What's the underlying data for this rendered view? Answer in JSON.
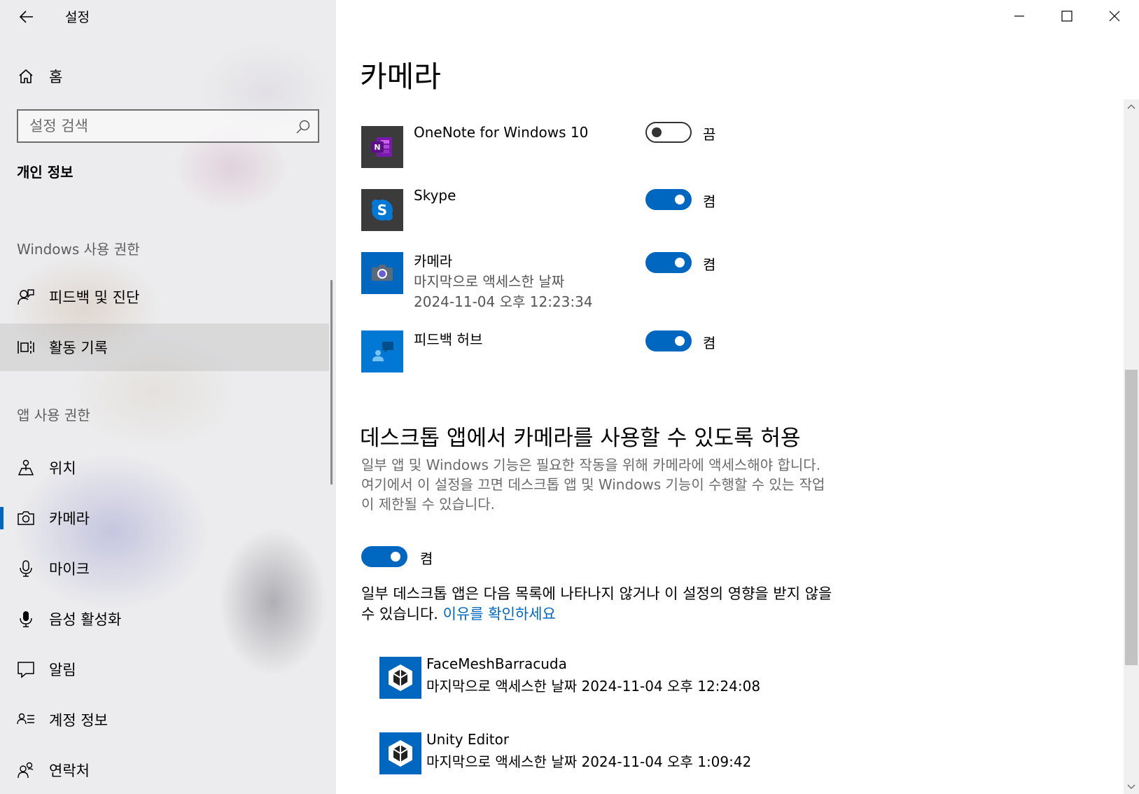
{
  "window": {
    "app_title": "설정",
    "back_icon": "back-arrow-icon",
    "minimize_icon": "minimize-icon",
    "maximize_icon": "maximize-icon",
    "close_icon": "close-icon"
  },
  "sidebar": {
    "home": {
      "label": "홈",
      "icon": "home-icon"
    },
    "search": {
      "placeholder": "설정 검색",
      "value": "",
      "icon": "search-icon"
    },
    "category": "개인 정보",
    "windows_section": "Windows 사용 권한",
    "windows_items": [
      {
        "label": "피드백 및 진단",
        "icon": "feedback-icon"
      },
      {
        "label": "활동 기록",
        "icon": "activity-history-icon"
      }
    ],
    "app_section": "앱 사용 권한",
    "app_items": [
      {
        "label": "위치",
        "icon": "location-icon"
      },
      {
        "label": "카메라",
        "icon": "camera-icon"
      },
      {
        "label": "마이크",
        "icon": "microphone-icon"
      },
      {
        "label": "음성 활성화",
        "icon": "voice-activation-icon"
      },
      {
        "label": "알림",
        "icon": "notifications-icon"
      },
      {
        "label": "계정 정보",
        "icon": "account-info-icon"
      },
      {
        "label": "연락처",
        "icon": "contacts-icon"
      }
    ],
    "active_item": "카메라",
    "hover_item": "활동 기록"
  },
  "main": {
    "title": "카메라",
    "apps": [
      {
        "name": "OneNote for Windows 10",
        "icon": "onenote-icon",
        "toggle": false,
        "state_label": "끔"
      },
      {
        "name": "Skype",
        "icon": "skype-icon",
        "toggle": true,
        "state_label": "켬"
      },
      {
        "name": "카메라",
        "icon": "camera-app-icon",
        "toggle": true,
        "state_label": "켬",
        "sub1": "마지막으로 액세스한 날짜",
        "sub2": "2024-11-04 오후 12:23:34"
      },
      {
        "name": "피드백 허브",
        "icon": "feedback-hub-icon",
        "toggle": true,
        "state_label": "켬"
      }
    ],
    "desktop_section": {
      "title": "데스크톱 앱에서 카메라를 사용할 수 있도록 허용",
      "description": "일부 앱 및 Windows 기능은 필요한 작동을 위해 카메라에 액세스해야 합니다. 여기에서 이 설정을 끄면 데스크톱 앱 및 Windows 기능이 수행할 수 있는 작업이 제한될 수 있습니다.",
      "toggle": true,
      "state_label": "켬",
      "note": "일부 데스크톱 앱은 다음 목록에 나타나지 않거나 이 설정의 영향을 받지 않을 수 있습니다. ",
      "link": "이유를 확인하세요",
      "apps": [
        {
          "name": "FaceMeshBarracuda",
          "icon": "unity-icon",
          "accessed": "마지막으로 액세스한 날짜 2024-11-04 오후 12:24:08"
        },
        {
          "name": "Unity Editor",
          "icon": "unity-icon",
          "accessed": "마지막으로 액세스한 날짜 2024-11-04 오후 1:09:42"
        }
      ]
    }
  },
  "colors": {
    "accent": "#0067c0",
    "sidebar_bg": "#ececee",
    "onenote": "#7719aa",
    "skype": "#0078d4"
  }
}
